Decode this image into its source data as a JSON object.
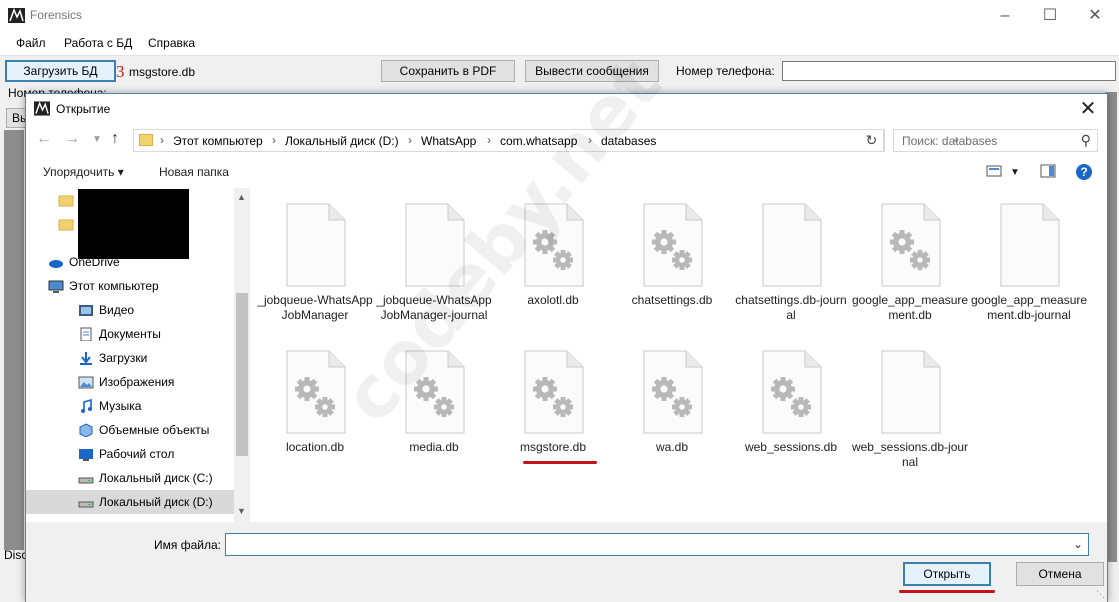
{
  "app": {
    "title": "Forensics",
    "menu": [
      "Файл",
      "Работа с БД",
      "Справка"
    ],
    "toolbar": {
      "load_db": "Загрузить БД",
      "step_number": "3",
      "loaded_file": "msgstore.db",
      "save_pdf": "Сохранить в PDF",
      "show_messages": "Вывести сообщения",
      "phone_label": "Номер телефона:",
      "phone_value": ""
    },
    "background": {
      "partial_label": "Номер телефона:",
      "partial_button": "Вы",
      "partial_bottom": "Disc"
    }
  },
  "dialog": {
    "title": "Открытие",
    "breadcrumb": [
      "Этот компьютер",
      "Локальный диск (D:)",
      "WhatsApp",
      "com.whatsapp",
      "databases"
    ],
    "search_placeholder": "Поиск: databases",
    "commands": {
      "organize": "Упорядочить",
      "new_folder": "Новая папка"
    },
    "nav_items": [
      {
        "label": "",
        "icon": "folder-icon"
      },
      {
        "label": "",
        "icon": "folder-icon"
      },
      {
        "label": "OneDrive",
        "icon": "cloud-icon"
      },
      {
        "label": "Этот компьютер",
        "icon": "computer-icon"
      },
      {
        "label": "Видео",
        "icon": "video-icon"
      },
      {
        "label": "Документы",
        "icon": "documents-icon"
      },
      {
        "label": "Загрузки",
        "icon": "download-icon"
      },
      {
        "label": "Изображения",
        "icon": "pictures-icon"
      },
      {
        "label": "Музыка",
        "icon": "music-icon"
      },
      {
        "label": "Объемные объекты",
        "icon": "3d-objects-icon"
      },
      {
        "label": "Рабочий стол",
        "icon": "desktop-icon"
      },
      {
        "label": "Локальный диск (C:)",
        "icon": "drive-icon"
      },
      {
        "label": "Локальный диск (D:)",
        "icon": "drive-icon",
        "selected": true
      }
    ],
    "files": [
      {
        "name": "_jobqueue-WhatsAppJobManager",
        "icon": "blank-file-icon"
      },
      {
        "name": "_jobqueue-WhatsAppJobManager-journal",
        "icon": "blank-file-icon"
      },
      {
        "name": "axolotl.db",
        "icon": "gear-file-icon"
      },
      {
        "name": "chatsettings.db",
        "icon": "gear-file-icon"
      },
      {
        "name": "chatsettings.db-journal",
        "icon": "blank-file-icon"
      },
      {
        "name": "google_app_measurement.db",
        "icon": "gear-file-icon"
      },
      {
        "name": "google_app_measurement.db-journal",
        "icon": "blank-file-icon"
      },
      {
        "name": "location.db",
        "icon": "gear-file-icon"
      },
      {
        "name": "media.db",
        "icon": "gear-file-icon"
      },
      {
        "name": "msgstore.db",
        "icon": "gear-file-icon",
        "highlighted": true
      },
      {
        "name": "wa.db",
        "icon": "gear-file-icon"
      },
      {
        "name": "web_sessions.db",
        "icon": "gear-file-icon"
      },
      {
        "name": "web_sessions.db-journal",
        "icon": "blank-file-icon"
      }
    ],
    "filename_label": "Имя файла:",
    "filename_value": "",
    "open_button": "Открыть",
    "cancel_button": "Отмена"
  },
  "watermark": "codeby.net",
  "colors": {
    "accent": "#3c7fb1",
    "annotation_red": "#c0161a",
    "selected_bg": "#d9d9d9"
  }
}
